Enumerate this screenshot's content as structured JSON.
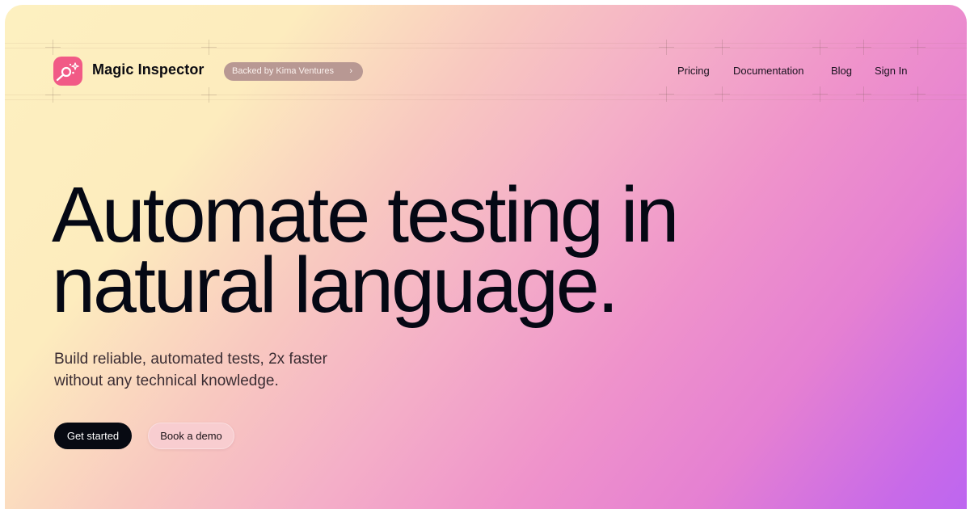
{
  "brand": {
    "name": "Magic Inspector",
    "logo_icon": "magic-wand-magnifier-icon",
    "logo_color": "#f15a86"
  },
  "badge": {
    "label": "Backed by Kima Ventures",
    "icon": "chevron-right-icon",
    "chevron": "›"
  },
  "nav": {
    "items": [
      {
        "label": "Pricing"
      },
      {
        "label": "Documentation"
      },
      {
        "label": "Blog"
      },
      {
        "label": "Sign In"
      }
    ]
  },
  "hero": {
    "title_line1": "Automate testing in",
    "title_line2": "natural language.",
    "subtitle_line1": "Build reliable, automated tests, 2x faster",
    "subtitle_line2": "without any technical knowledge."
  },
  "cta": {
    "primary_label": "Get started",
    "secondary_label": "Book a demo"
  },
  "colors": {
    "gradient": [
      "#fdf0c0",
      "#f4aec8",
      "#e580d2",
      "#bd66f0"
    ],
    "text_dark": "#050814",
    "badge_bg": "#b89893"
  }
}
